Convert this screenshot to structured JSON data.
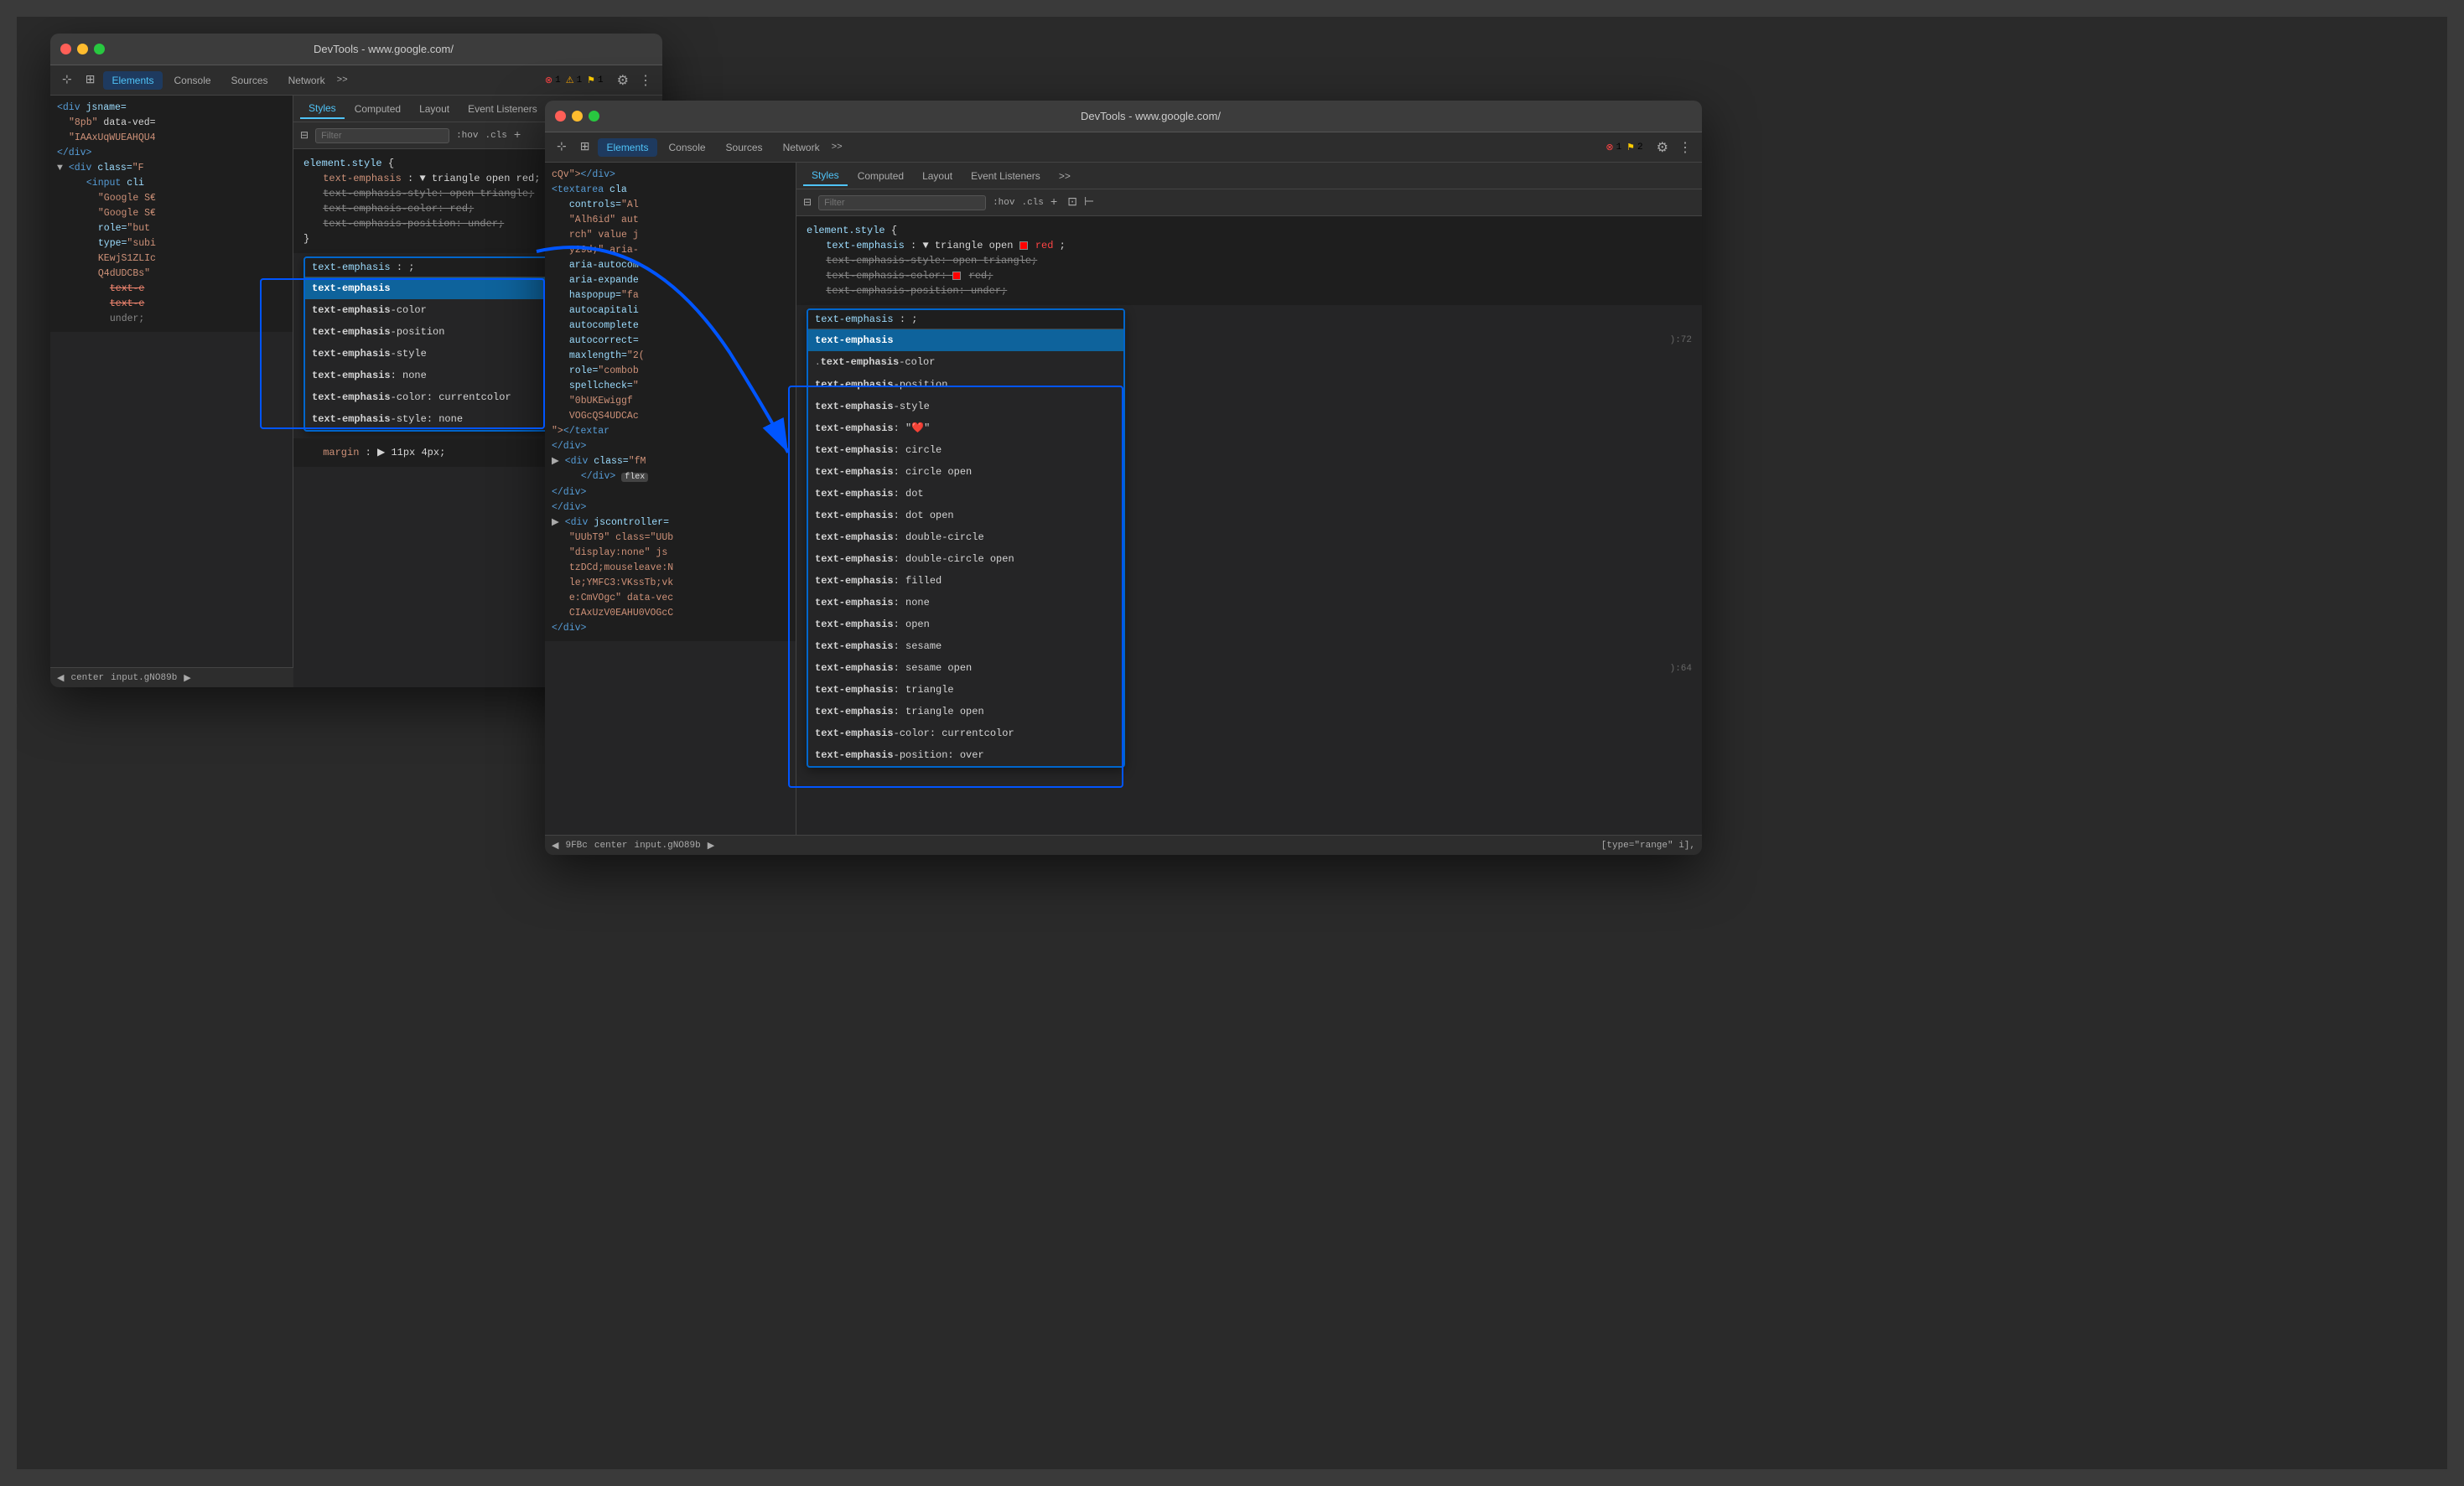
{
  "windows": {
    "back": {
      "title": "DevTools - www.google.com/",
      "tabs": [
        "Elements",
        "Console",
        "Sources",
        "Network"
      ],
      "more": ">>",
      "errors": {
        "error": "1",
        "warn": "1",
        "info": "1"
      },
      "stylesTabs": [
        "Styles",
        "Computed",
        "Layout",
        "Event Listeners"
      ],
      "filterPlaceholder": "Filter",
      "cssContent": [
        "element.style {",
        "  text-emphasis: ▼ triangle open red;",
        "  text-emphasis-style: open triangle;",
        "  text-emphasis-color: red;",
        "  text-emphasis-position: under;",
        "}"
      ],
      "autocomplete": {
        "inputValue": "text-emphasis: ;",
        "items": [
          "text-emphasis",
          "text-emphasis-color",
          "text-emphasis-position",
          "text-emphasis-style",
          "text-emphasis: none",
          "text-emphasis-color: currentcolor",
          "text-emphasis-style: none"
        ],
        "selectedIndex": 0
      },
      "margin": "margin: ▶ 11px 4px;"
    },
    "front": {
      "title": "DevTools - www.google.com/",
      "tabs": [
        "Elements",
        "Console",
        "Sources",
        "Network"
      ],
      "more": ">>",
      "errors": {
        "error": "1",
        "info": "2"
      },
      "stylesTabs": [
        "Styles",
        "Computed",
        "Layout",
        "Event Listeners"
      ],
      "filterPlaceholder": "Filter",
      "htmlPanel": {
        "lines": [
          "cQv\"></div>",
          "<textarea cla",
          "  controls=\"Al",
          "  \"Alh6id\" aut",
          "  rch\" value j",
          "  y29d;\" aria-",
          "  aria-autocom",
          "  aria-expande",
          "  haspopup=\"fa",
          "  autocapitali",
          "  autocomplete",
          "  autocorrect=",
          "  maxlength=\"2",
          "  role=\"combo",
          "  spellcheck=\"",
          "  \"0bUKEwiggf",
          "  VOGcQS4UDCAc",
          "\"></textar",
          "</div>",
          "▶ <div class=\"fM",
          "  </div> flex",
          "</div>",
          "</div>",
          "▶ <div jscontroll",
          "  \"UUbT9\" class=\"UU",
          "  \"display:none\" js",
          "  tzDCd;mouseleave:",
          "  le;YMFC3:VKssTb;vk",
          "  e:CmVOgc\" data-ve",
          "  CIAxUzV0EAHU0VOGcC",
          "</div>"
        ]
      },
      "cssContent": [
        "element.style {",
        "  text-emphasis: ▼ triangle open ■ red;",
        "  text-emphasis-style: open triangle;",
        "  text-emphasis-color: ■ red;",
        "  text-emphasis-position: under;"
      ],
      "autocomplete": {
        "inputValue": "text-emphasis: ;",
        "items": [
          "text-emphasis",
          "text-emphasis-color",
          "text-emphasis-position",
          "text-emphasis-style",
          "text-emphasis: \"❤\"",
          "text-emphasis: circle",
          "text-emphasis: circle open",
          "text-emphasis: dot",
          "text-emphasis: dot open",
          "text-emphasis: double-circle",
          "text-emphasis: double-circle open",
          "text-emphasis: filled",
          "text-emphasis: none",
          "text-emphasis: open",
          "text-emphasis: sesame",
          "text-emphasis: sesame open",
          "text-emphasis: triangle",
          "text-emphasis: triangle open",
          "text-emphasis-color: currentcolor",
          "text-emphasis-position: over"
        ],
        "selectedIndex": 0
      },
      "statusBar": {
        "items": [
          "9FBc",
          "center",
          "input.gNO89b"
        ]
      },
      "statusBarRight": "[type=\"range\" i],"
    }
  },
  "icons": {
    "cursor": "⊹",
    "layers": "⊞",
    "gear": "⚙",
    "dots": "⋮",
    "filter": "⊟",
    "plus": "+",
    "styles_icons": "⊡ ⊢",
    "arrow_right": "▶",
    "arrow_down": "▼",
    "error_icon": "⊗",
    "warning_icon": "⚠",
    "info_icon": "⚑"
  }
}
